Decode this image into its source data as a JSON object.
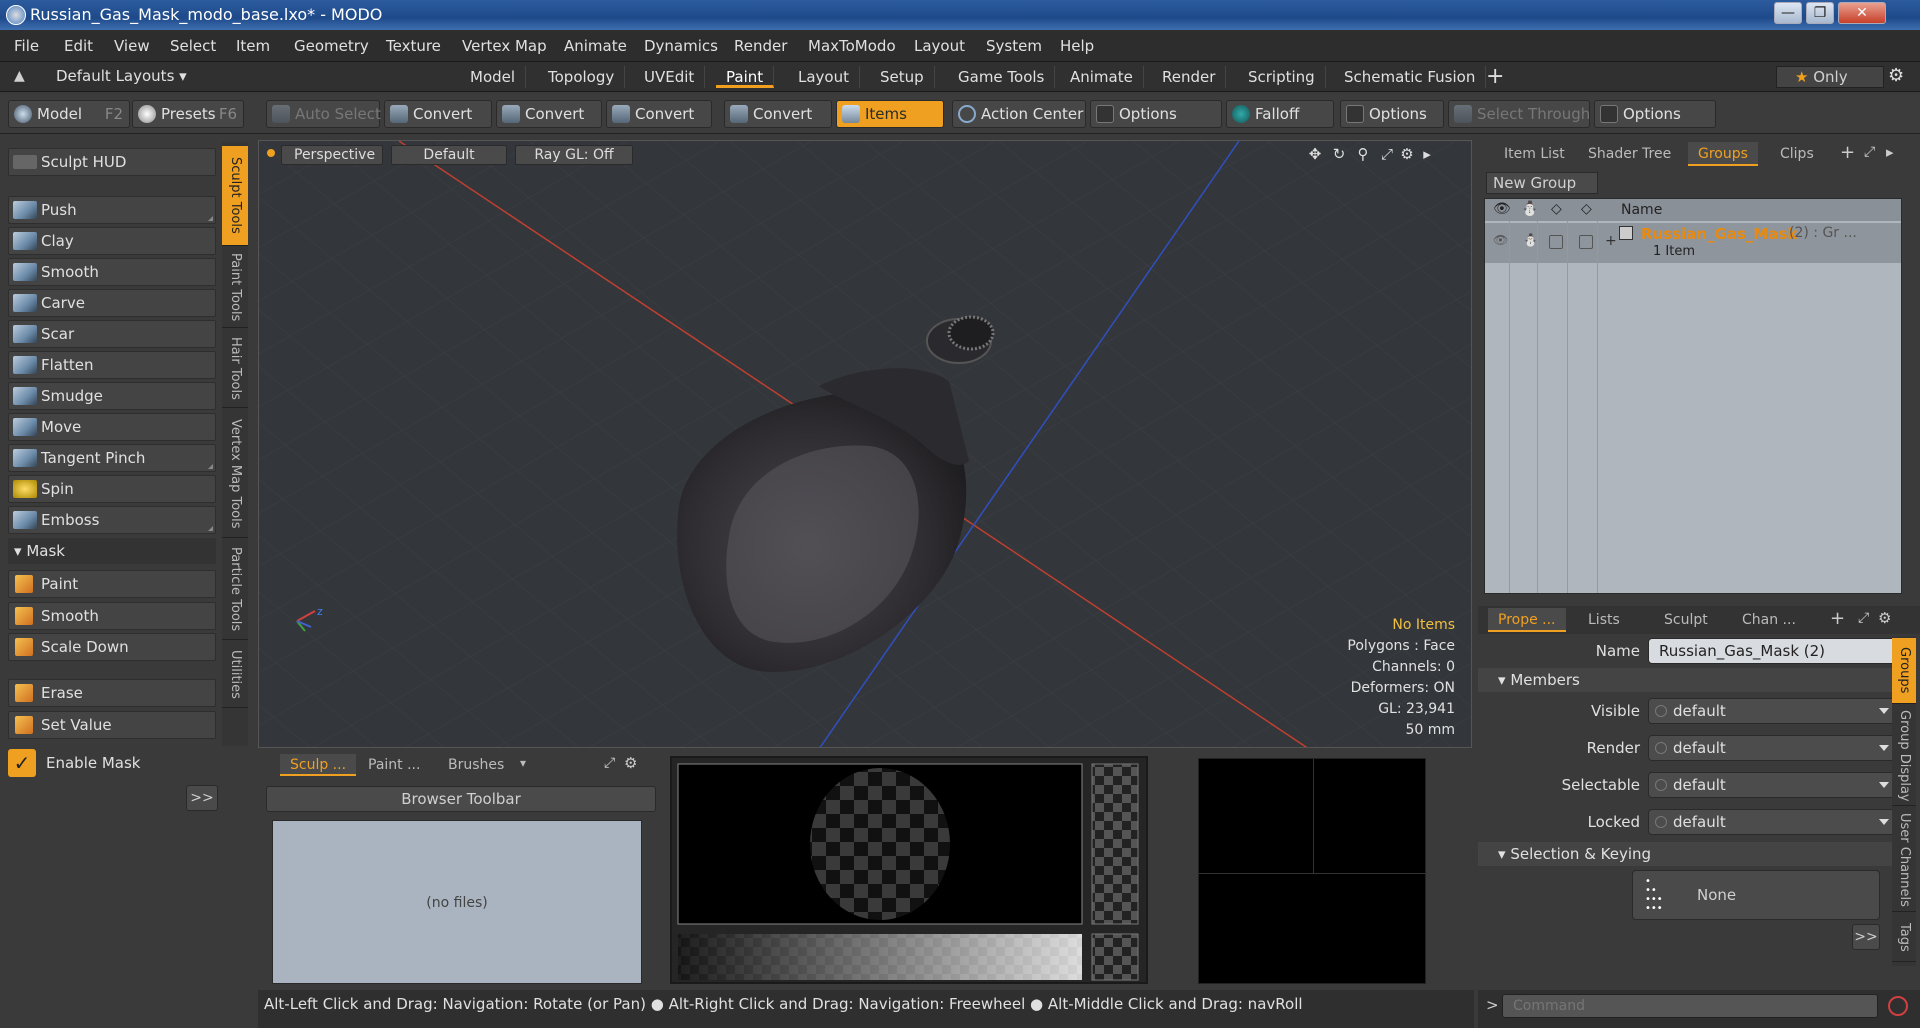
{
  "window": {
    "title": "Russian_Gas_Mask_modo_base.lxo* - MODO"
  },
  "menu": [
    "File",
    "Edit",
    "View",
    "Select",
    "Item",
    "Geometry",
    "Texture",
    "Vertex Map",
    "Animate",
    "Dynamics",
    "Render",
    "MaxToModo",
    "Layout",
    "System",
    "Help"
  ],
  "layout_tabs": {
    "preset": "Default Layouts",
    "tabs": [
      "Model",
      "Topology",
      "UVEdit",
      "Paint",
      "Layout",
      "Setup",
      "Game Tools",
      "Animate",
      "Render",
      "Scripting",
      "Schematic Fusion"
    ],
    "active": "Paint",
    "only_label": "Only"
  },
  "toolbar": {
    "model": "Model",
    "model_key": "F2",
    "presets": "Presets",
    "presets_key": "F6",
    "auto_select": "Auto Select",
    "convert1": "Convert",
    "convert2": "Convert",
    "convert3": "Convert",
    "convert4": "Convert",
    "items": "Items",
    "action_center": "Action Center",
    "options1": "Options",
    "falloff": "Falloff",
    "options2": "Options",
    "select_through": "Select Through",
    "options3": "Options"
  },
  "sculpt": {
    "hud": "Sculpt HUD",
    "tools": [
      "Push",
      "Clay",
      "Smooth",
      "Carve",
      "Scar",
      "Flatten",
      "Smudge",
      "Move",
      "Tangent Pinch",
      "Spin",
      "Emboss"
    ],
    "mask_header": "Mask",
    "mask_tools": [
      "Paint",
      "Smooth",
      "Scale Down"
    ],
    "erase": "Erase",
    "set_value": "Set Value",
    "enable_mask": "Enable Mask",
    "more": ">>"
  },
  "side_tabs": [
    "Sculpt Tools",
    "Paint Tools",
    "Hair Tools",
    "Vertex Map Tools",
    "Particle Tools",
    "Utilities"
  ],
  "viewport": {
    "view": "Perspective",
    "shading": "Default",
    "raygl": "Ray GL: Off",
    "hud": {
      "items": "No Items",
      "polygons": "Polygons : Face",
      "channels": "Channels: 0",
      "deformers": "Deformers: ON",
      "gl": "GL: 23,941",
      "focal": "50 mm"
    }
  },
  "browser": {
    "tabs": [
      "Sculp ...",
      "Paint ...",
      "Brushes"
    ],
    "toolbar": "Browser Toolbar",
    "empty": "(no files)"
  },
  "groups_panel": {
    "tabs": [
      "Item List",
      "Shader Tree",
      "Groups",
      "Clips"
    ],
    "active": "Groups",
    "new_group": "New Group",
    "col_name": "Name",
    "group_name": "Russian_Gas_Mask",
    "group_suffix": "(2) : Gr ...",
    "group_count": "1 Item"
  },
  "properties": {
    "tabs": [
      "Prope ...",
      "Lists",
      "Sculpt",
      "Chan ..."
    ],
    "name_label": "Name",
    "name_value": "Russian_Gas_Mask (2)",
    "members_header": "Members",
    "rows": [
      {
        "label": "Visible",
        "value": "default"
      },
      {
        "label": "Render",
        "value": "default"
      },
      {
        "label": "Selectable",
        "value": "default"
      },
      {
        "label": "Locked",
        "value": "default"
      }
    ],
    "selection_header": "Selection & Keying",
    "none_label": "None",
    "more": ">>",
    "side_tabs": [
      "Groups",
      "Group Display",
      "User Channels",
      "Tags"
    ]
  },
  "status": "Alt-Left Click and Drag: Navigation: Rotate (or Pan) ● Alt-Right Click and Drag: Navigation: Freewheel ● Alt-Middle Click and Drag: navRoll",
  "command": {
    "placeholder": "Command"
  },
  "colors": {
    "accent": "#f0a020",
    "bg": "#3a3a3a",
    "viewport": "#33363a"
  }
}
